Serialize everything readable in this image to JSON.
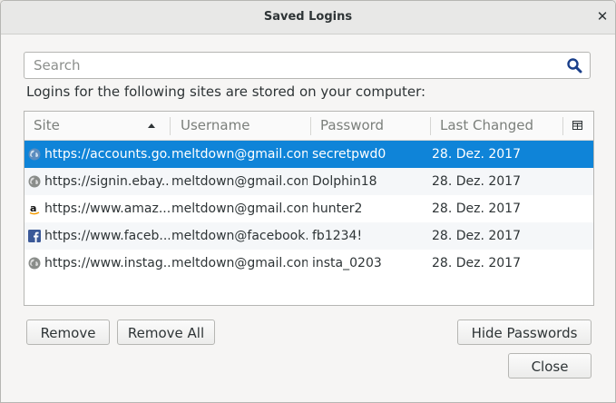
{
  "window": {
    "title": "Saved Logins"
  },
  "search": {
    "placeholder": "Search"
  },
  "intro_text": "Logins for the following sites are stored on your computer:",
  "columns": {
    "site": "Site",
    "username": "Username",
    "password": "Password",
    "last_changed": "Last Changed"
  },
  "rows": [
    {
      "site": "https://accounts.go...",
      "username": "meltdown@gmail.com",
      "password": "secretpwd0",
      "last_changed": "28. Dez. 2017",
      "icon": "globe-icon"
    },
    {
      "site": "https://signin.ebay....",
      "username": "meltdown@gmail.com",
      "password": "Dolphin18",
      "last_changed": "28. Dez. 2017",
      "icon": "globe-icon"
    },
    {
      "site": "https://www.amaz...",
      "username": "meltdown@gmail.com",
      "password": "hunter2",
      "last_changed": "28. Dez. 2017",
      "icon": "amazon-icon"
    },
    {
      "site": "https://www.faceb...",
      "username": "meltdown@facebook...",
      "password": "fb1234!",
      "last_changed": "28. Dez. 2017",
      "icon": "facebook-icon"
    },
    {
      "site": "https://www.instag...",
      "username": "meltdown@gmail.com",
      "password": "insta_0203",
      "last_changed": "28. Dez. 2017",
      "icon": "globe-icon"
    }
  ],
  "buttons": {
    "remove": "Remove",
    "remove_all": "Remove All",
    "hide_passwords": "Hide Passwords",
    "close": "Close"
  },
  "colors": {
    "selection": "#0f84d8"
  }
}
